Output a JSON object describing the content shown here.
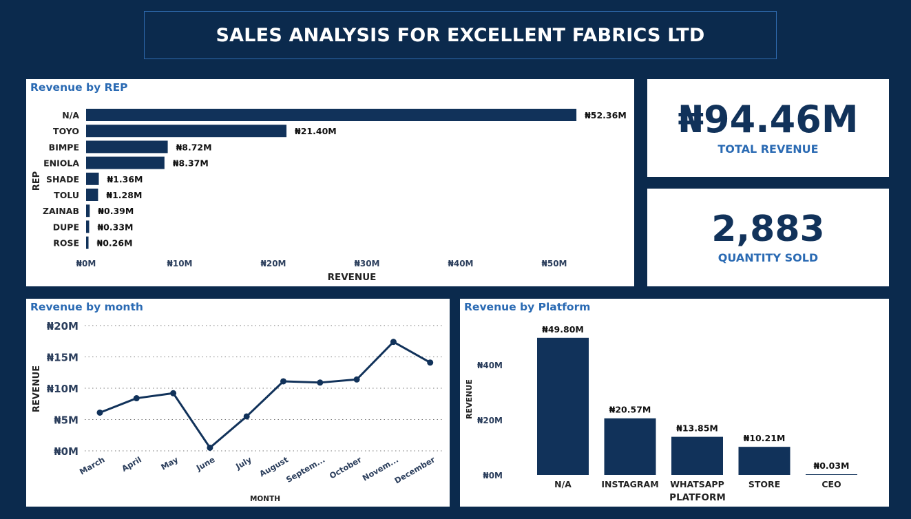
{
  "header": {
    "title": "SALES ANALYSIS FOR EXCELLENT FABRICS LTD"
  },
  "colors": {
    "background": "#0b2a4d",
    "bar": "#11325a",
    "title_blue": "#2a6ab3",
    "panel": "#ffffff"
  },
  "kpis": {
    "total_revenue": {
      "value": "₦94.46M",
      "label": "TOTAL REVENUE"
    },
    "quantity_sold": {
      "value": "2,883",
      "label": "QUANTITY SOLD"
    }
  },
  "chart_data": [
    {
      "id": "rep",
      "type": "bar",
      "orientation": "horizontal",
      "title": "Revenue by REP",
      "xlabel": "REVENUE",
      "ylabel": "REP",
      "categories": [
        "N/A",
        "TOYO",
        "BIMPE",
        "ENIOLA",
        "SHADE",
        "TOLU",
        "ZAINAB",
        "DUPE",
        "ROSE"
      ],
      "values": [
        52.36,
        21.4,
        8.72,
        8.37,
        1.36,
        1.28,
        0.39,
        0.33,
        0.26
      ],
      "value_labels": [
        "₦52.36M",
        "₦21.40M",
        "₦8.72M",
        "₦8.37M",
        "₦1.36M",
        "₦1.28M",
        "₦0.39M",
        "₦0.33M",
        "₦0.26M"
      ],
      "xlim": [
        0,
        55
      ],
      "ticks": [
        0,
        10,
        20,
        30,
        40,
        50
      ],
      "tick_labels": [
        "₦0M",
        "₦10M",
        "₦20M",
        "₦30M",
        "₦40M",
        "₦50M"
      ],
      "unit": "M"
    },
    {
      "id": "month",
      "type": "line",
      "title": "Revenue by month",
      "xlabel": "MONTH",
      "ylabel": "REVENUE",
      "categories": [
        "March",
        "April",
        "May",
        "June",
        "July",
        "August",
        "Septem...",
        "October",
        "Novem...",
        "December"
      ],
      "values": [
        6.1,
        8.4,
        9.2,
        0.5,
        5.5,
        11.1,
        10.9,
        11.4,
        17.4,
        14.1
      ],
      "ylim": [
        0,
        20
      ],
      "ticks": [
        0,
        5,
        10,
        15,
        20
      ],
      "tick_labels": [
        "₦0M",
        "₦5M",
        "₦10M",
        "₦15M",
        "₦20M"
      ],
      "grid": true,
      "unit": "M"
    },
    {
      "id": "platform",
      "type": "bar",
      "orientation": "vertical",
      "title": "Revenue by Platform",
      "xlabel": "PLATFORM",
      "ylabel": "REVENUE",
      "categories": [
        "N/A",
        "INSTAGRAM",
        "WHATSAPP",
        "STORE",
        "CEO"
      ],
      "values": [
        49.8,
        20.57,
        13.85,
        10.21,
        0.03
      ],
      "value_labels": [
        "₦49.80M",
        "₦20.57M",
        "₦13.85M",
        "₦10.21M",
        "₦0.03M"
      ],
      "ylim": [
        0,
        50
      ],
      "ticks": [
        0,
        20,
        40
      ],
      "tick_labels": [
        "₦0M",
        "₦20M",
        "₦40M"
      ],
      "unit": "M"
    }
  ]
}
